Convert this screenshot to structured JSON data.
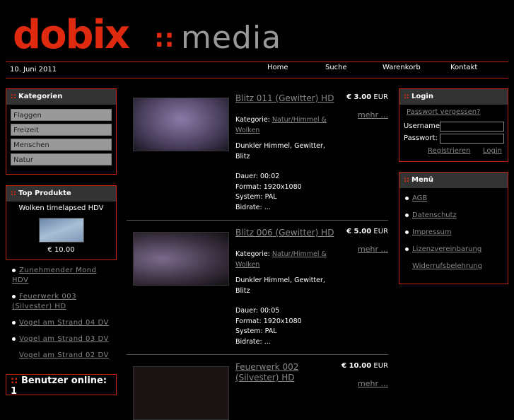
{
  "logo": {
    "brand": "dobix",
    "sep": "::",
    "suffix": "media"
  },
  "date": "10. Juni 2011",
  "nav": [
    "Home",
    "Suche",
    "Warenkorb",
    "Kontakt"
  ],
  "kategorien": {
    "title": "Kategorien",
    "items": [
      "Flaggen",
      "Freizeit",
      "Menschen",
      "Natur"
    ]
  },
  "top": {
    "title": "Top Produkte",
    "name": "Wolken timelapsed HDV",
    "price": "€ 10.00"
  },
  "toplist": [
    "Zunehmender Mond HDV",
    "Feuerwerk 003 (Silvester) HD",
    "Vogel am Strand 04 DV",
    "Vogel am Strand 03 DV",
    "Vogel am Strand 02 DV"
  ],
  "online": "Benutzer online: 1",
  "products": [
    {
      "title": "Blitz 011 (Gewitter) HD",
      "price": "€ 3.00",
      "currency": "EUR",
      "more": "mehr ...",
      "cat_label": "Kategorie:",
      "cat": "Natur/Himmel & Wolken",
      "desc": "Dunkler Himmel, Gewitter, Blitz",
      "dauer": "Dauer: 00:02",
      "format": "Format: 1920x1080",
      "system": "System: PAL",
      "bitrate": "Bidrate: ..."
    },
    {
      "title": "Blitz 006 (Gewitter) HD",
      "price": "€ 5.00",
      "currency": "EUR",
      "more": "mehr ...",
      "cat_label": "Kategorie:",
      "cat": "Natur/Himmel & Wolken",
      "desc": "Dunkler Himmel, Gewitter, Blitz",
      "dauer": "Dauer: 00:05",
      "format": "Format: 1920x1080",
      "system": "System: PAL",
      "bitrate": "Bidrate: ..."
    },
    {
      "title": "Feuerwerk 002 (Silvester) HD",
      "price": "€ 10.00",
      "currency": "EUR",
      "more": "mehr ..."
    }
  ],
  "login": {
    "title": "Login",
    "forgot": "Passwort vergessen?",
    "user": "Username:",
    "pass": "Passwort:",
    "register": "Registrieren",
    "login": "Login"
  },
  "menu": {
    "title": "Menü",
    "items": [
      "AGB",
      "Datenschutz",
      "Impressum",
      "Lizenzvereinbarung",
      "Widerrufsbelehrung"
    ]
  }
}
